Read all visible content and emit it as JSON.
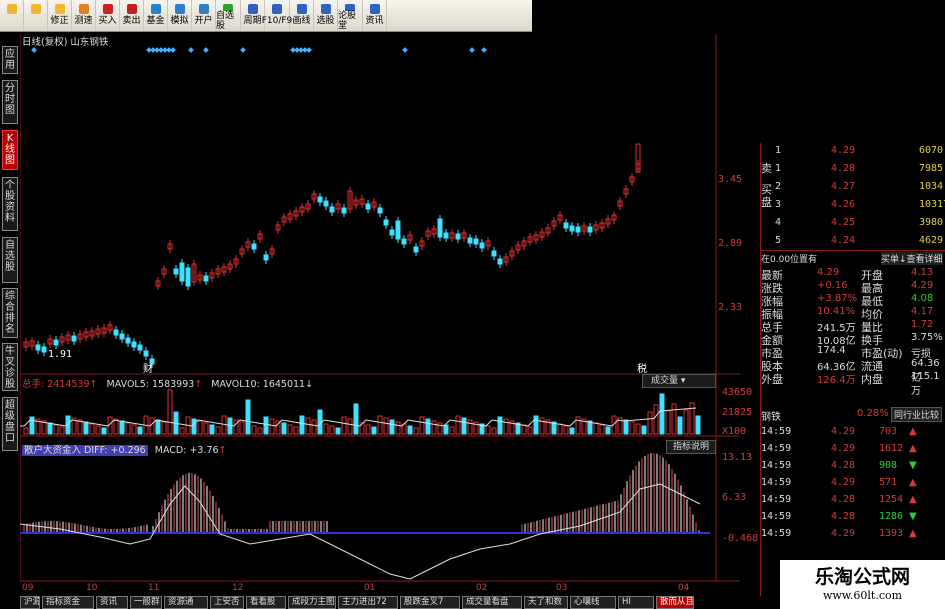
{
  "toolbar": {
    "buttons": [
      "",
      "",
      "修正",
      "测速",
      "买入",
      "卖出",
      "基金",
      "模拟",
      "开户",
      "自选股",
      "周期",
      "F10/F9",
      "画线",
      "选股",
      "论股堂",
      "资讯"
    ]
  },
  "left_tabs": [
    "应用",
    "分时图",
    "K线图",
    "个股资料",
    "自选股",
    "综合排名",
    "牛叉诊股",
    "超级盘口"
  ],
  "chart": {
    "header": "日线(复权)  山东钢铁",
    "price_labels": [
      "3.45",
      "2.89",
      "2.33"
    ],
    "low_label": "1.91",
    "mark_left": "财",
    "mark_right": "税",
    "vol_title": "总手: 2414539",
    "vol_ma5": "MAVOL5: 1583993",
    "vol_ma10": "MAVOL10: 1645011",
    "vol_btn": "成交量",
    "vol_labels": [
      "43650",
      "21825",
      "X100"
    ],
    "macd_ind": "散户大资金入 DIFF: +0.296",
    "macd_val": "MACD: +3.76",
    "macd_btn": "指标说明",
    "macd_labels": [
      "13.13",
      "6.33",
      "-0.468"
    ],
    "months": [
      "09",
      "10",
      "11",
      "12",
      "01",
      "02",
      "03",
      "04"
    ],
    "colors": {
      "up": "#e03030",
      "down": "#40e0ff",
      "ma": "#e0e0e0"
    }
  },
  "order_book": {
    "sell_label": "卖",
    "buy_label": "买盘",
    "rows": [
      {
        "n": "1",
        "p": "4.29",
        "v": "6070"
      },
      {
        "n": "1",
        "p": "4.28",
        "v": "7985"
      },
      {
        "n": "2",
        "p": "4.27",
        "v": "1034"
      },
      {
        "n": "3",
        "p": "4.26",
        "v": "10317"
      },
      {
        "n": "4",
        "p": "4.25",
        "v": "3980"
      },
      {
        "n": "5",
        "p": "4.24",
        "v": "4629"
      }
    ],
    "pos_text": "在0.00位置有",
    "pos_link": "买单↓查看详细"
  },
  "quote": {
    "left": [
      [
        "最新",
        "4.29"
      ],
      [
        "涨跌",
        "+0.16"
      ],
      [
        "涨幅",
        "+3.87%"
      ],
      [
        "振幅",
        "10.41%"
      ],
      [
        "总手",
        "241.5万"
      ],
      [
        "金额",
        "10.08亿"
      ],
      [
        "市盈",
        "174.4"
      ],
      [
        "股本",
        "64.36亿"
      ],
      [
        "外盘",
        "126.4万"
      ]
    ],
    "right": [
      [
        "开盘",
        "4.13"
      ],
      [
        "最高",
        "4.29"
      ],
      [
        "最低",
        "4.08"
      ],
      [
        "均价",
        "4.17"
      ],
      [
        "量比",
        "1.72"
      ],
      [
        "换手",
        "3.75%"
      ],
      [
        "市盈(动)",
        "亏损"
      ],
      [
        "流通",
        "64.36亿"
      ],
      [
        "内盘",
        "115.1万"
      ]
    ]
  },
  "industry": {
    "name": "钢铁",
    "pct": "0.28%",
    "btn": "同行业比较"
  },
  "ticks": [
    {
      "t": "14:59",
      "p": "4.29",
      "v": "703",
      "d": "up"
    },
    {
      "t": "14:59",
      "p": "4.29",
      "v": "1612",
      "d": "up"
    },
    {
      "t": "14:59",
      "p": "4.28",
      "v": "908",
      "d": "down"
    },
    {
      "t": "14:59",
      "p": "4.29",
      "v": "571",
      "d": "up"
    },
    {
      "t": "14:59",
      "p": "4.28",
      "v": "1254",
      "d": "up"
    },
    {
      "t": "14:59",
      "p": "4.28",
      "v": "1286",
      "d": "down"
    },
    {
      "t": "14:59",
      "p": "4.29",
      "v": "1393",
      "d": "up"
    }
  ],
  "bottom_tabs": [
    "沪源",
    "指标资金",
    "资讯",
    "一般群",
    "资源通",
    "上安否",
    "看看股",
    "成段力主图副图",
    "主力进出72",
    "股跌金叉7",
    "成交量看盘",
    "天了和数",
    "心嚷线",
    "HI",
    "散而从且出人"
  ],
  "watermark": {
    "cn": "乐淘公式网",
    "url": "www.60lt.com"
  }
}
